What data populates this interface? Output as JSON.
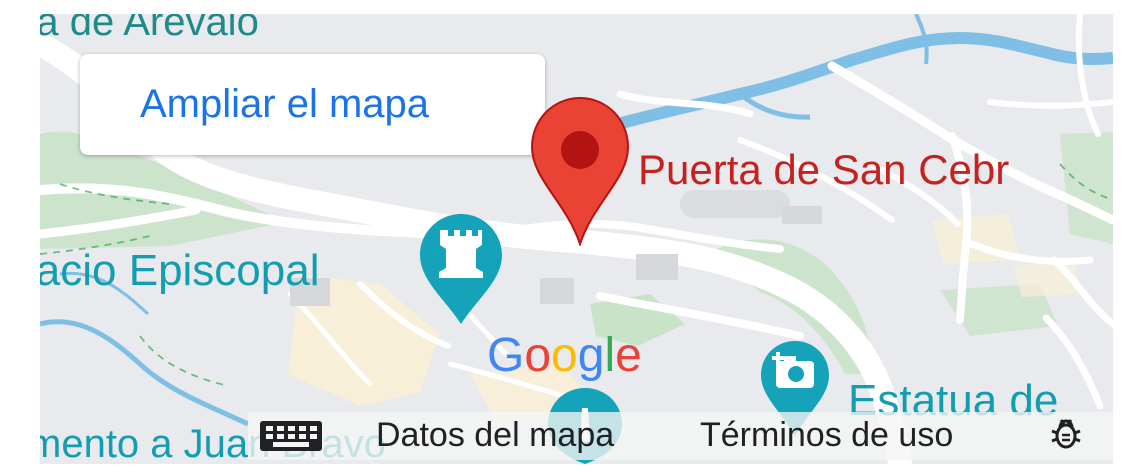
{
  "map": {
    "expand_link": "Ampliar el mapa",
    "places": {
      "top_left": "rta de Arevalo",
      "selected_place": "Puerta de San Cebr",
      "episcopal": "lacio Episcopal",
      "estatua": "Estatua de",
      "bottom_left": "mento a Juan Bravo"
    },
    "attribution": {
      "g1": "G",
      "o1": "o",
      "o2": "o",
      "g2": "g",
      "l": "l",
      "e": "e"
    },
    "footer": {
      "map_data": "Datos del mapa",
      "terms": "Términos de uso"
    },
    "icons": {
      "marker": "red-location-pin-icon",
      "castle": "castle-poi-icon",
      "camera": "camera-poi-icon",
      "monument": "monument-poi-icon",
      "keyboard": "keyboard-shortcuts-icon",
      "bug": "report-bug-icon"
    },
    "colors": {
      "background": "#e8eaed",
      "road": "#ffffff",
      "water": "#7fbfe6",
      "park": "#b7dfb1",
      "urban": "#f8efd6",
      "pin": "#ea4335",
      "poi": "#14a3b8",
      "link": "#1a73e8"
    }
  }
}
